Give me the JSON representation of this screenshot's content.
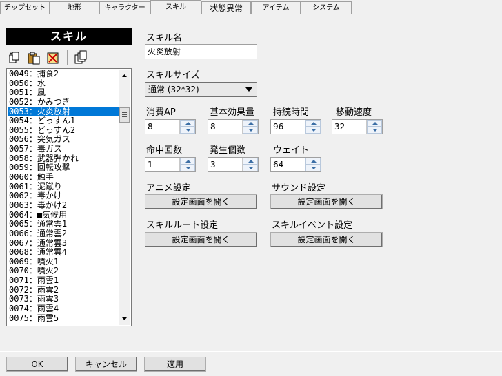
{
  "tabs": [
    {
      "label": "チップセット",
      "active": false
    },
    {
      "label": "地形",
      "active": false
    },
    {
      "label": "キャラクター",
      "active": false
    },
    {
      "label": "スキル",
      "active": true
    },
    {
      "label": "状態異常",
      "active": false
    },
    {
      "label": "アイテム",
      "active": false
    },
    {
      "label": "システム",
      "active": false
    }
  ],
  "panel": {
    "title": "スキル"
  },
  "toolbar": {
    "icons": [
      "copy-icon",
      "paste-icon",
      "clear-icon",
      "duplicate-icon"
    ]
  },
  "skill_list": {
    "selected_index": 4,
    "items": [
      "0049：捕食2",
      "0050：水",
      "0051：風",
      "0052：かみつき",
      "0053：火炎放射",
      "0054：どっすん1",
      "0055：どっすん2",
      "0056：突気ガス",
      "0057：毒ガス",
      "0058：武器弾かれ",
      "0059：回転攻撃",
      "0060：触手",
      "0061：泥蹴り",
      "0062：毒かけ",
      "0063：毒かけ2",
      "0064：■気候用",
      "0065：通常雲1",
      "0066：通常雲2",
      "0067：通常雲3",
      "0068：通常雲4",
      "0069：噴火1",
      "0070：噴火2",
      "0071：雨雲1",
      "0072：雨雲2",
      "0073：雨雲3",
      "0074：雨雲4",
      "0075：雨雲5"
    ]
  },
  "form": {
    "skill_name_label": "スキル名",
    "skill_name_value": "火炎放射",
    "skill_size_label": "スキルサイズ",
    "skill_size_value": "通常 (32*32)",
    "mp_label": "消費AP",
    "mp_value": "8",
    "base_effect_label": "基本効果量",
    "base_effect_value": "8",
    "duration_label": "持続時間",
    "duration_value": "96",
    "move_speed_label": "移動速度",
    "move_speed_value": "32",
    "hit_count_label": "命中回数",
    "hit_count_value": "1",
    "spawn_count_label": "発生個数",
    "spawn_count_value": "3",
    "wait_label": "ウェイト",
    "wait_value": "64",
    "anime_label": "アニメ設定",
    "anime_button": "設定画面を開く",
    "sound_label": "サウンド設定",
    "sound_button": "設定画面を開く",
    "route_label": "スキルルート設定",
    "route_button": "設定画面を開く",
    "event_label": "スキルイベント設定",
    "event_button": "設定画面を開く"
  },
  "footer": {
    "ok": "OK",
    "cancel": "キャンセル",
    "apply": "適用"
  },
  "colors": {
    "selection": "#0078d7",
    "title_bg": "#000000"
  }
}
